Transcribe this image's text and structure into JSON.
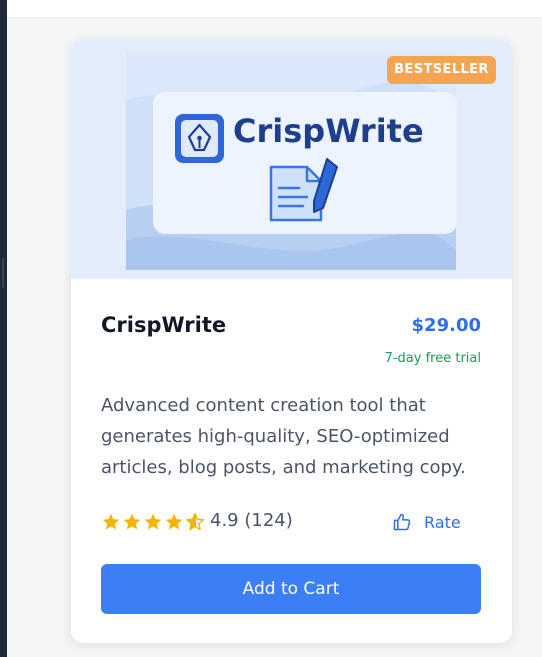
{
  "product": {
    "logo_text": "CrispWrite",
    "badge": "BESTSELLER",
    "name": "CrispWrite",
    "price": "$29.00",
    "trial": "7-day free trial",
    "description": "Advanced content creation tool that generates high-quality, SEO-optimized articles, blog posts, and marketing copy.",
    "rating_value": 4.9,
    "rating_text": "4.9 (124)",
    "rate_label": "Rate",
    "add_to_cart_label": "Add to Cart"
  },
  "colors": {
    "accent": "#3b7ef5",
    "price": "#2f6fe8",
    "trial": "#1a9a55",
    "badge": "#f5a452",
    "star": "#f4b400"
  },
  "icons": {
    "logo": "pen-nib-icon",
    "hero_document": "document-pencil-icon",
    "rate": "thumbs-up-icon",
    "star": "star-icon"
  }
}
